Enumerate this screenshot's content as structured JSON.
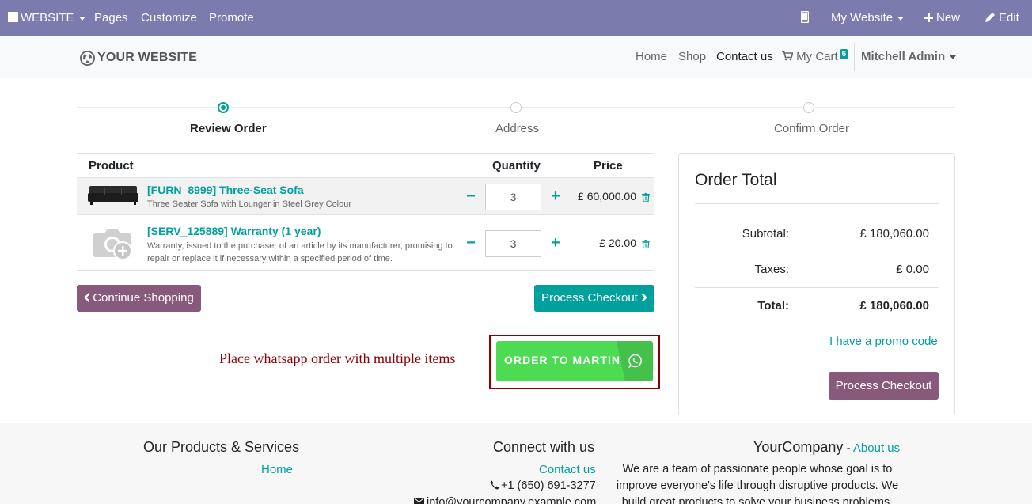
{
  "admin_bar": {
    "website_label": "WEBSITE",
    "pages_label": "Pages",
    "customize_label": "Customize",
    "promote_label": "Promote",
    "my_website_label": "My Website",
    "new_label": "New",
    "edit_label": "Edit"
  },
  "header": {
    "logo_text": "YOUR WEBSITE",
    "nav": {
      "home": "Home",
      "shop": "Shop",
      "contact": "Contact us",
      "cart": "My Cart",
      "cart_count": "6"
    },
    "user_name": "Mitchell Admin"
  },
  "progress": {
    "steps": [
      "Review Order",
      "Address",
      "Confirm Order"
    ],
    "active_step": 0
  },
  "cart": {
    "headers": {
      "product": "Product",
      "quantity": "Quantity",
      "price": "Price"
    },
    "items": [
      {
        "name": "[FURN_8999] Three-Seat Sofa",
        "description": "Three Seater Sofa with Lounger in Steel Grey Colour",
        "quantity": "3",
        "price": "£ 60,000.00"
      },
      {
        "name": "[SERV_125889] Warranty (1 year)",
        "description": "Warranty, issued to the purchaser of an article by its manufacturer, promising to repair or replace it if necessary within a specified period of time.",
        "quantity": "3",
        "price": "£ 20.00"
      }
    ],
    "continue_label": "Continue Shopping",
    "checkout_label": "Process Checkout"
  },
  "whatsapp": {
    "note": "Place whatsapp order with multiple items",
    "button_label": "ORDER TO MARTIN"
  },
  "order_total": {
    "title": "Order Total",
    "subtotal_label": "Subtotal:",
    "subtotal_value": "£ 180,060.00",
    "taxes_label": "Taxes:",
    "taxes_value": "£ 0.00",
    "total_label": "Total:",
    "total_value": "£ 180,060.00",
    "promo_label": "I have a promo code",
    "checkout_label": "Process Checkout"
  },
  "footer": {
    "products_heading": "Our Products & Services",
    "home_link": "Home",
    "connect_heading": "Connect with us",
    "contact_link": "Contact us",
    "phone": "+1 (650) 691-3277",
    "email": "info@yourcompany.example.com",
    "company_name": "YourCompany",
    "company_separator": " - ",
    "about_link": "About us",
    "company_text": "We are a team of passionate people whose goal is to improve everyone's life through disruptive products. We build great products to solve your business problems."
  },
  "colors": {
    "admin_bar": "#7c7bad",
    "accent": "#00a09d",
    "purple_button": "#875a7b",
    "whatsapp_green": "#4cdb53",
    "annotation_red": "#8b0000"
  }
}
